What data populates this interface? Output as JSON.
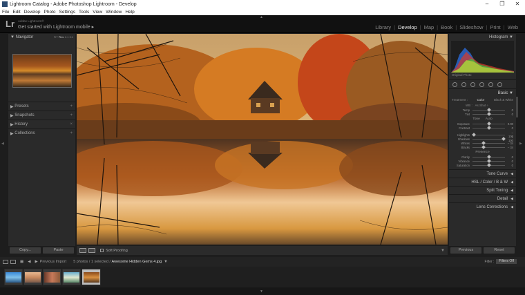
{
  "window": {
    "title": "Lightroom Catalog - Adobe Photoshop Lightroom - Develop",
    "controls": [
      "–",
      "❐",
      "✕"
    ]
  },
  "menu": [
    "File",
    "Edit",
    "Develop",
    "Photo",
    "Settings",
    "Tools",
    "View",
    "Window",
    "Help"
  ],
  "identity": {
    "logo": "Lr",
    "sub": "Adobe Lightroom®",
    "main": "Get started with Lightroom mobile  ▸"
  },
  "modules": [
    "Library",
    "Develop",
    "Map",
    "Book",
    "Slideshow",
    "Print",
    "Web"
  ],
  "active_module": "Develop",
  "navigator": {
    "label": "Navigator",
    "zoom": [
      "FIT",
      "FILL",
      "1:1",
      "3:1"
    ],
    "active_zoom": "FILL"
  },
  "left_sections": [
    {
      "label": "Presets"
    },
    {
      "label": "Snapshots"
    },
    {
      "label": "History"
    },
    {
      "label": "Collections"
    }
  ],
  "left_buttons": {
    "copy": "Copy...",
    "paste": "Paste"
  },
  "toolbar": {
    "soft_proofing": "Soft Proofing"
  },
  "histogram": {
    "label": "Histogram",
    "original_photo": "Original Photo"
  },
  "basic": {
    "label": "Basic",
    "treatment_label": "Treatment :",
    "color": "Color",
    "bw": "Black & White",
    "wb_label": "WB :",
    "wb_value": "As Shot ÷",
    "tone_label": "Tone",
    "auto": "Auto",
    "presence_label": "Presence",
    "wb_sliders": [
      {
        "label": "Temp",
        "value": "0",
        "pos": 0.5
      },
      {
        "label": "Tint",
        "value": "0",
        "pos": 0.5
      }
    ],
    "tone_sliders": [
      {
        "label": "Exposure",
        "value": "0.00",
        "pos": 0.5
      },
      {
        "label": "Contrast",
        "value": "0",
        "pos": 0.5
      }
    ],
    "tone_sliders2": [
      {
        "label": "Highlights",
        "value": "– 100",
        "pos": 0.05
      },
      {
        "label": "Shadows",
        "value": "+ 100",
        "pos": 0.95
      },
      {
        "label": "Whites",
        "value": "– 34",
        "pos": 0.33
      },
      {
        "label": "Blacks",
        "value": "– 34",
        "pos": 0.33
      }
    ],
    "presence_sliders": [
      {
        "label": "Clarity",
        "value": "0",
        "pos": 0.5
      },
      {
        "label": "Vibrance",
        "value": "0",
        "pos": 0.5
      },
      {
        "label": "Saturation",
        "value": "0",
        "pos": 0.5
      }
    ]
  },
  "right_sections": {
    "tone_curve": "Tone Curve",
    "hsl": "HSL  /  Color  /  B & W",
    "split_toning": "Split Toning",
    "detail": "Detail",
    "lens_corrections": "Lens Corrections"
  },
  "right_buttons": {
    "previous": "Previous",
    "reset": "Reset"
  },
  "filmbar": {
    "previous_import": "Previous Import",
    "count": "5 photos / 1 selected /",
    "file": "Awesome Hidden Gems 4.jpg",
    "filter_label": "Filter :",
    "filter_value": "Filters Off"
  },
  "filmstrip_thumbs": 5,
  "selected_thumb_index": 4
}
